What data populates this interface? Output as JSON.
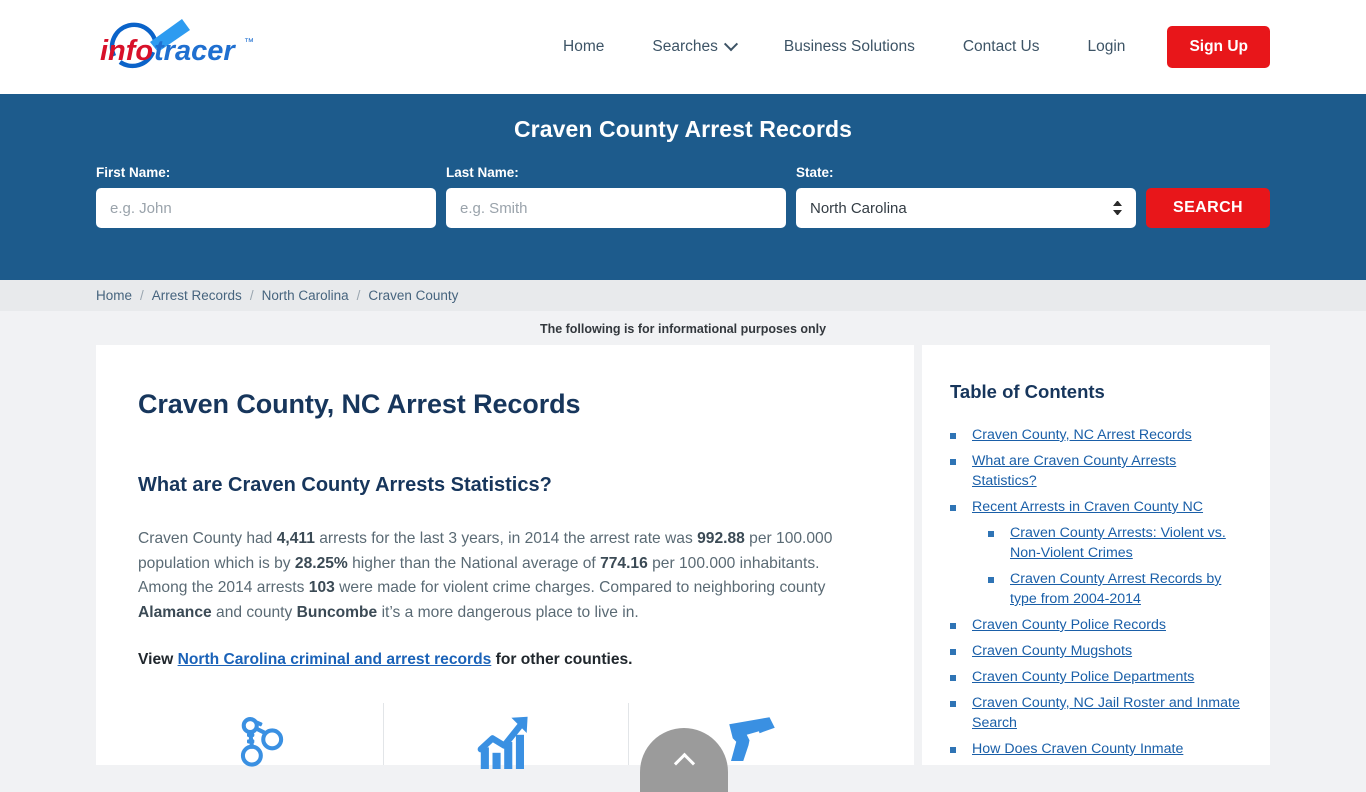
{
  "header": {
    "logo": {
      "name": "infotracer-logo",
      "word1": "info",
      "word2": "tracer",
      "tm": "™"
    },
    "nav": [
      {
        "label": "Home",
        "name": "nav-home"
      },
      {
        "label": "Searches",
        "name": "nav-searches",
        "has_caret": true
      },
      {
        "label": "Business Solutions",
        "name": "nav-business-solutions"
      },
      {
        "label": "Contact Us",
        "name": "nav-contact-us"
      },
      {
        "label": "Login",
        "name": "nav-login"
      }
    ],
    "signup_label": "Sign Up",
    "accent_red": "#e8161a",
    "nav_text_color": "#3d5466"
  },
  "search_banner": {
    "title": "Craven County Arrest Records",
    "background": "#1d5b8c",
    "first_name": {
      "label": "First Name:",
      "placeholder": "e.g. John",
      "value": ""
    },
    "last_name": {
      "label": "Last Name:",
      "placeholder": "e.g. Smith",
      "value": ""
    },
    "state": {
      "label": "State:",
      "selected": "North Carolina",
      "options": [
        "North Carolina"
      ]
    },
    "search_button": "SEARCH"
  },
  "breadcrumb": {
    "separator": "/",
    "items": [
      {
        "label": "Home"
      },
      {
        "label": "Arrest Records"
      },
      {
        "label": "North Carolina"
      },
      {
        "label": "Craven County"
      }
    ]
  },
  "notice": "The following is for informational purposes only",
  "article": {
    "h1": "Craven County, NC Arrest Records",
    "h2": "What are Craven County Arrests Statistics?",
    "paragraph": {
      "p1": "Craven County had ",
      "b1": "4,411",
      "p2": " arrests for the last 3 years, in 2014 the arrest rate was ",
      "b2": "992.88",
      "p3": " per 100.000 population which is by ",
      "b3": "28.25%",
      "p4": " higher than the National average of ",
      "b4": "774.16",
      "p5": " per 100.000 inhabitants. Among the 2014 arrests ",
      "b5": "103",
      "p6": " were made for violent crime charges. Compared to neighboring county ",
      "b6": "Alamance",
      "p7": " and county ",
      "b7": "Buncombe",
      "p8": " it’s a more dangerous place to live in."
    },
    "view_line": {
      "prefix": "View ",
      "link": "North Carolina criminal and arrest records",
      "suffix": " for other counties."
    },
    "icons": [
      {
        "name": "handcuffs-icon",
        "color": "#3a90e2"
      },
      {
        "name": "growth-chart-icon",
        "color": "#3a90e2"
      },
      {
        "name": "handgun-icon",
        "color": "#3a90e2"
      }
    ]
  },
  "toc": {
    "title": "Table of Contents",
    "link_color": "#1a5fa8",
    "bullet_color": "#2f74b5",
    "items": [
      {
        "label": "Craven County, NC Arrest Records",
        "children": []
      },
      {
        "label": "What are Craven County Arrests Statistics?",
        "children": []
      },
      {
        "label": "Recent Arrests in Craven County NC",
        "children": [
          {
            "label": "Craven County Arrests: Violent vs. Non-Violent Crimes"
          },
          {
            "label": "Craven County Arrest Records by type from 2004-2014"
          }
        ]
      },
      {
        "label": "Craven County Police Records",
        "children": []
      },
      {
        "label": "Craven County Mugshots",
        "children": []
      },
      {
        "label": "Craven County Police Departments",
        "children": []
      },
      {
        "label": "Craven County, NC Jail Roster and Inmate Search",
        "children": []
      },
      {
        "label": "How Does Craven County Inmate",
        "children": []
      }
    ]
  },
  "scroll_top": {
    "name": "scroll-to-top-button",
    "color": "#9b9b9b"
  }
}
